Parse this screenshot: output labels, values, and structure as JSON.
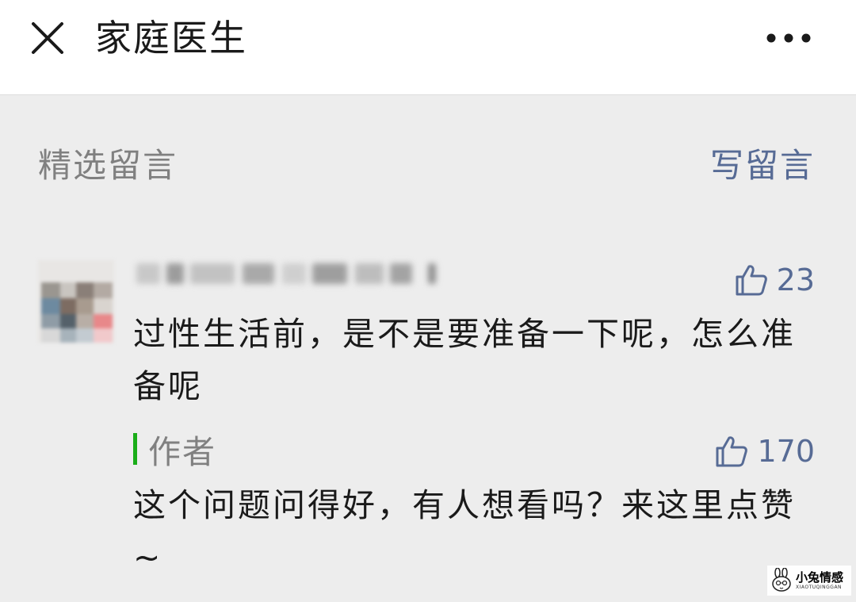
{
  "header": {
    "title": "家庭医生",
    "close_icon": "close-icon",
    "more_icon": "more-icon"
  },
  "section": {
    "title": "精选留言",
    "write_link": "写留言"
  },
  "comment": {
    "likes": "23",
    "text": "过性生活前，是不是要准备一下呢，怎么准备呢",
    "reply": {
      "author_label": "作者",
      "likes": "170",
      "text": "这个问题问得好，有人想看吗？来这里点赞~"
    }
  },
  "watermark": {
    "main": "小兔情感",
    "sub": "XIAOTUQINGGAN"
  },
  "colors": {
    "link": "#576b95",
    "author_accent": "#1aad19",
    "background": "#ededed",
    "muted": "#808080"
  }
}
